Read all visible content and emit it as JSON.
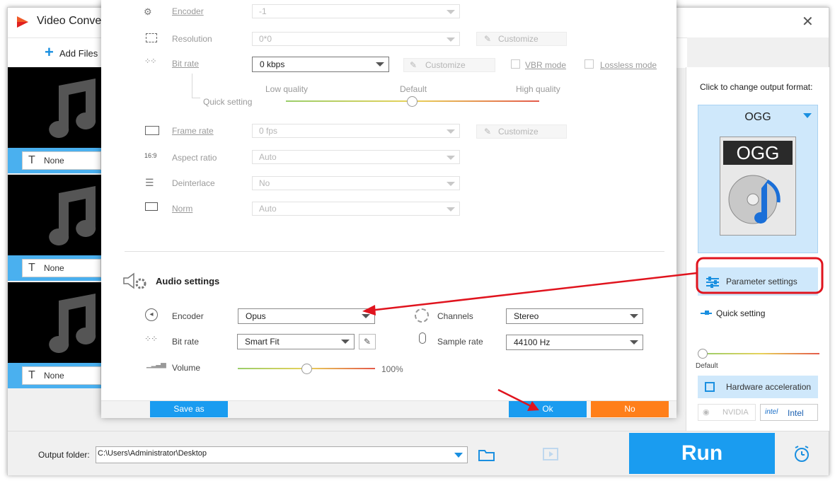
{
  "window": {
    "title": "Video Conve",
    "close_icon": "close-icon"
  },
  "toolbar": {
    "add_files": "Add Files"
  },
  "files": [
    {
      "subtitle": "None"
    },
    {
      "subtitle": "None"
    },
    {
      "subtitle": "None"
    }
  ],
  "right_panel": {
    "change_format_label": "Click to change output format:",
    "format": "OGG",
    "format_badge": "OGG",
    "parameter_settings": "Parameter settings",
    "quick_setting": "Quick setting",
    "quick_setting_value": "Default",
    "hardware_acceleration": "Hardware acceleration",
    "nvidia": "NVIDIA",
    "intel": "Intel"
  },
  "bottom": {
    "output_folder_label": "Output folder:",
    "output_folder_value": "C:\\Users\\Administrator\\Desktop",
    "run": "Run"
  },
  "dialog": {
    "video": {
      "encoder_label": "Encoder",
      "encoder_value": "-1",
      "resolution_label": "Resolution",
      "resolution_value": "0*0",
      "resolution_customize": "Customize",
      "bitrate_label": "Bit rate",
      "bitrate_value": "0 kbps",
      "bitrate_customize": "Customize",
      "vbr_mode": "VBR mode",
      "lossless_mode": "Lossless mode",
      "quick_setting_label": "Quick setting",
      "quality_low": "Low quality",
      "quality_default": "Default",
      "quality_high": "High quality",
      "framerate_label": "Frame rate",
      "framerate_value": "0 fps",
      "framerate_customize": "Customize",
      "aspect_label": "Aspect ratio",
      "aspect_value": "Auto",
      "deinterlace_label": "Deinterlace",
      "deinterlace_value": "No",
      "norm_label": "Norm",
      "norm_value": "Auto"
    },
    "audio": {
      "section_title": "Audio settings",
      "encoder_label": "Encoder",
      "encoder_value": "Opus",
      "bitrate_label": "Bit rate",
      "bitrate_value": "Smart Fit",
      "volume_label": "Volume",
      "volume_value": "100%",
      "channels_label": "Channels",
      "channels_value": "Stereo",
      "samplerate_label": "Sample rate",
      "samplerate_value": "44100 Hz"
    },
    "buttons": {
      "save_as": "Save as",
      "ok": "Ok",
      "no": "No"
    }
  },
  "colors": {
    "accent": "#1a9cf0",
    "orange": "#ff7f1a",
    "annotation": "#e0141e",
    "selected_bar": "#4ab0ef"
  }
}
